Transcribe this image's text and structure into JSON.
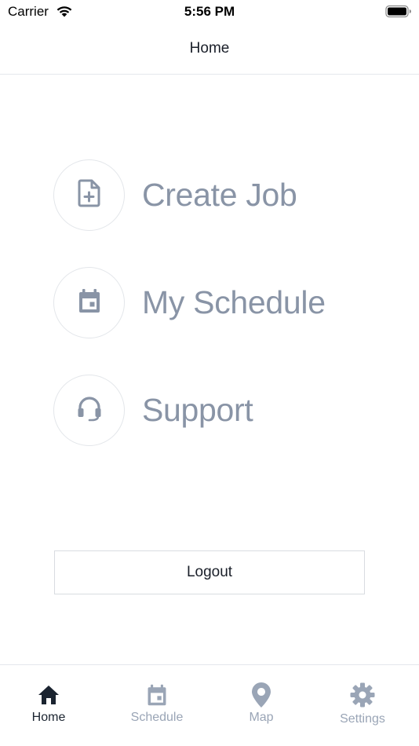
{
  "status_bar": {
    "carrier": "Carrier",
    "time": "5:56 PM"
  },
  "nav": {
    "title": "Home"
  },
  "menu": [
    {
      "label": "Create Job",
      "icon": "file-plus-icon"
    },
    {
      "label": "My Schedule",
      "icon": "calendar-icon"
    },
    {
      "label": "Support",
      "icon": "headset-icon"
    }
  ],
  "logout": {
    "label": "Logout"
  },
  "tabs": [
    {
      "label": "Home",
      "icon": "home-icon",
      "active": true
    },
    {
      "label": "Schedule",
      "icon": "calendar-icon",
      "active": false
    },
    {
      "label": "Map",
      "icon": "map-pin-icon",
      "active": false
    },
    {
      "label": "Settings",
      "icon": "gear-icon",
      "active": false
    }
  ],
  "colors": {
    "icon_gray": "#8994a6",
    "tab_active": "#1b2430",
    "tab_inactive": "#9aa5b6",
    "divider": "#e4e7ec"
  }
}
